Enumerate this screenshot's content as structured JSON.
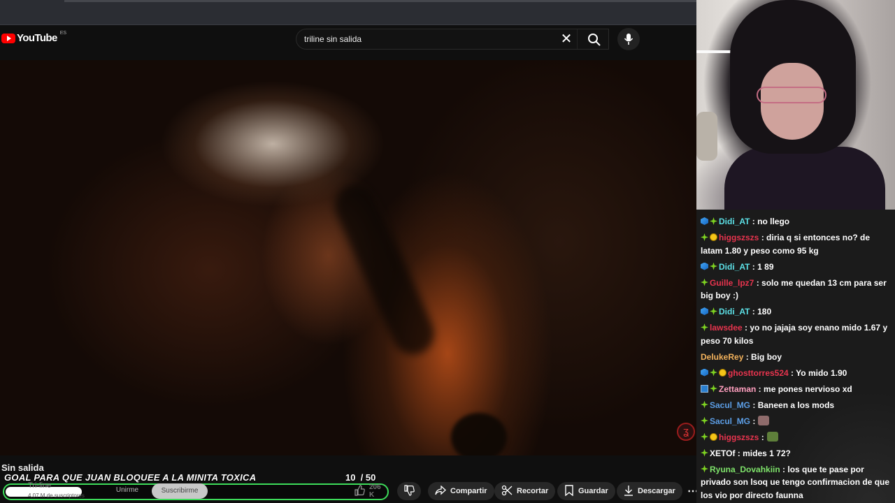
{
  "header": {
    "brand": "YouTube",
    "region": "ES",
    "search_value": "triline sin salida",
    "clear_glyph": "✕"
  },
  "video": {
    "title": "Sin salida"
  },
  "overlay": {
    "goal_text": "GOAL PARA QUE JUAN BLOQUEE A LA MINITA TOXICA",
    "goal_current": "10",
    "goal_total": "/ 50",
    "goal_progress": 0.2,
    "goal_color": "#3ddc5a"
  },
  "channel": {
    "name": "Tri-line",
    "subs": "4,07 M de suscriptores",
    "join_label": "Unirme",
    "subscribe_label": "Suscribirme"
  },
  "actions": {
    "like_count": "206 K",
    "share_label": "Compartir",
    "clip_label": "Recortar",
    "save_label": "Guardar",
    "download_label": "Descargar",
    "more_glyph": "⋯"
  },
  "chat": {
    "messages": [
      {
        "badges": [
          "cube",
          "diamond"
        ],
        "user": "Didi_AT",
        "color": "#5ce0e6",
        "text": " no llego"
      },
      {
        "badges": [
          "diamond",
          "coin"
        ],
        "user": "higgszszs",
        "color": "#e8344e",
        "text": " diria q si entonces no? de latam 1.80 y peso como 95 kg"
      },
      {
        "badges": [
          "cube",
          "diamond"
        ],
        "user": "Didi_AT",
        "color": "#5ce0e6",
        "text": " 1 89"
      },
      {
        "badges": [
          "diamond"
        ],
        "user": "Guille_lpz7",
        "color": "#e8344e",
        "text": " solo me quedan 13 cm para ser big boy :)"
      },
      {
        "badges": [
          "cube",
          "diamond"
        ],
        "user": "Didi_AT",
        "color": "#5ce0e6",
        "text": " 180"
      },
      {
        "badges": [
          "diamond"
        ],
        "user": "lawsdee",
        "color": "#e8344e",
        "text": " yo no jajaja soy enano mido 1.67 y peso 70 kilos"
      },
      {
        "badges": [],
        "user": "DelukeRey",
        "color": "#f2b25c",
        "text": " Big boy"
      },
      {
        "badges": [
          "cube",
          "diamond",
          "coin"
        ],
        "user": "ghosttorres524",
        "color": "#e8344e",
        "text": " Yo mido 1.90"
      },
      {
        "badges": [
          "prime",
          "diamond"
        ],
        "user": "Zettaman",
        "color": "#ff9fbf",
        "text": " me pones nervioso xd"
      },
      {
        "badges": [
          "diamond"
        ],
        "user": "Sacul_MG",
        "color": "#5c9ee6",
        "text": " Baneen a los mods"
      },
      {
        "badges": [
          "diamond"
        ],
        "user": "Sacul_MG",
        "color": "#5c9ee6",
        "text": "",
        "sticker": "#8e6b6b"
      },
      {
        "badges": [
          "diamond",
          "coin"
        ],
        "user": "higgszszs",
        "color": "#e8344e",
        "text": "",
        "sticker": "#5e7f3a"
      },
      {
        "badges": [
          "diamond"
        ],
        "user": "XETOf",
        "color": "#ffffff",
        "text": " mides 1 72?"
      },
      {
        "badges": [
          "diamond"
        ],
        "user": "Ryuna_Dovahkiin",
        "color": "#7ee36a",
        "text": " los que te pase por privado son lsoq ue tengo confirmacion de que los vio por directo faunna"
      }
    ]
  }
}
